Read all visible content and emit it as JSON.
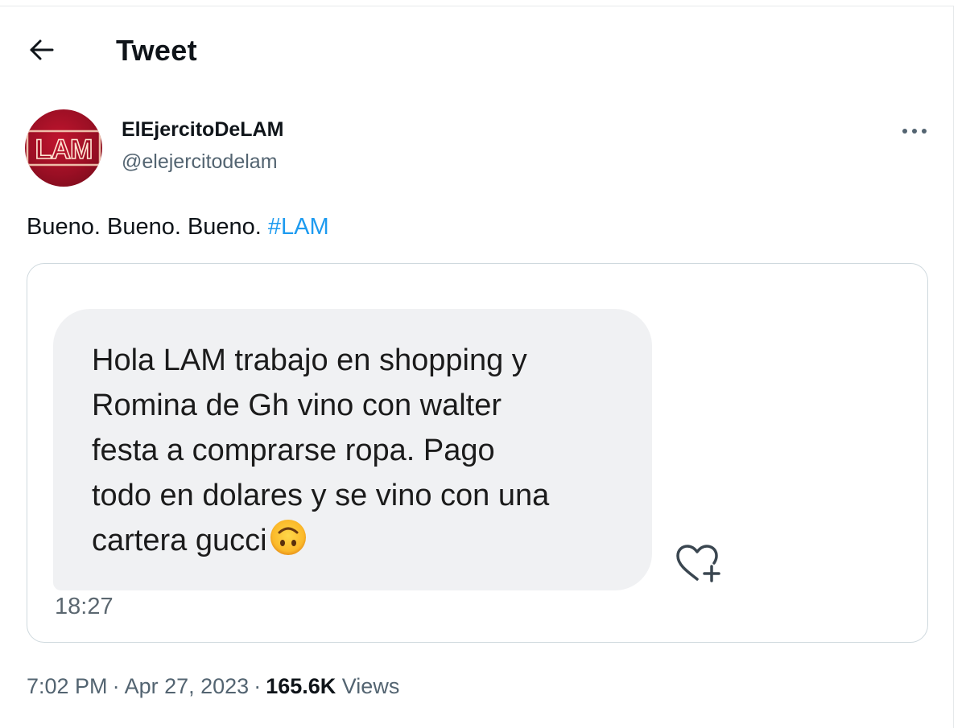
{
  "header": {
    "title": "Tweet"
  },
  "author": {
    "display_name": "ElEjercitoDeLAM",
    "username": "@elejercitodelam",
    "avatar_text": "LAM"
  },
  "tweet": {
    "text": "Bueno. Bueno. Bueno. ",
    "hashtag": "#LAM"
  },
  "media": {
    "message_lines": [
      "Hola LAM trabajo en shopping y",
      "Romina de Gh vino con walter",
      "festa a comprarse ropa. Pago",
      "todo en dolares y se vino con una",
      "cartera gucci"
    ],
    "emoji": "upside-down-face",
    "time": "18:27"
  },
  "meta": {
    "time": "7:02 PM",
    "separator": "·",
    "date": "Apr 27, 2023",
    "views_count": "165.6K",
    "views_label": "Views"
  },
  "colors": {
    "link": "#1d9bf0",
    "secondary_text": "#536471",
    "avatar_red": "#b0122a",
    "bubble_bg": "#f0f1f3",
    "card_border": "#cfd9de"
  },
  "icons": [
    "back-arrow-icon",
    "more-horizontal-icon",
    "heart-plus-icon",
    "upside-down-face-emoji"
  ]
}
